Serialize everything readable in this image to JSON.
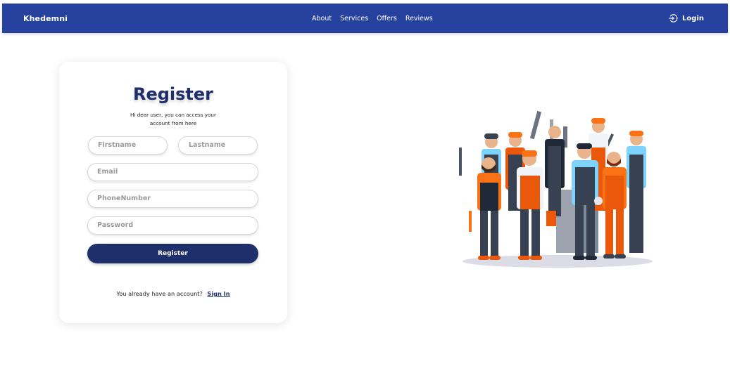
{
  "navbar": {
    "brand": "Khedemni",
    "links": [
      "About",
      "Services",
      "Offers",
      "Reviews"
    ],
    "login_label": "Login",
    "bg_color": "#27419e"
  },
  "register": {
    "title": "Register",
    "subtitle_line1": "Hi dear user, you can access your",
    "subtitle_line2": "account from here",
    "fields": {
      "firstname": "Firstname",
      "lastname": "Lastname",
      "email": "Email",
      "phone": "PhoneNumber",
      "password": "Password"
    },
    "submit_label": "Register",
    "have_account_text": "You already have an account?",
    "signin_label": "Sign In",
    "accent_color": "#1f2f6b"
  },
  "illustration": {
    "icon": "workers-group-illustration"
  }
}
